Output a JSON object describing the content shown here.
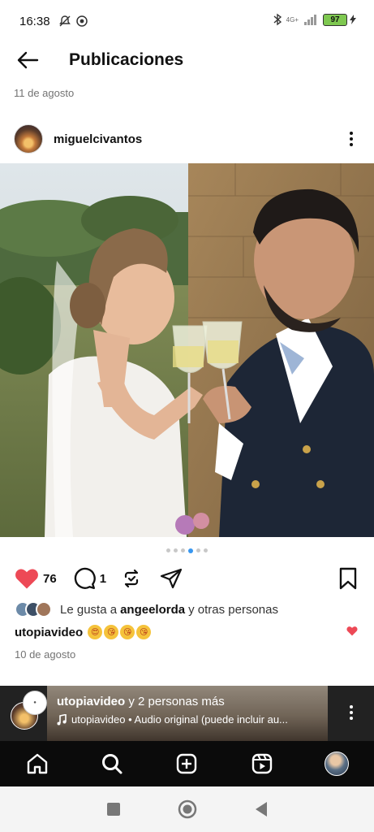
{
  "status_bar": {
    "time": "16:38",
    "network": "4G+",
    "battery": "97"
  },
  "header": {
    "title": "Publicaciones"
  },
  "post": {
    "date_top": "11 de agosto",
    "username": "miguelcivantos",
    "carousel": {
      "count": 6,
      "active_index": 3
    },
    "like_count": "76",
    "comment_count": "1",
    "likes_prefix": "Le gusta a",
    "likes_user": "angeelorda",
    "likes_suffix": "y otras personas",
    "caption_user": "utopiavideo",
    "caption_emoji": [
      "😍",
      "😘",
      "😘",
      "😘"
    ],
    "date_bottom": "10 de agosto"
  },
  "reel": {
    "title_user": "utopiavideo",
    "title_rest": "y 2 personas más",
    "subtitle": "utopiavideo • Audio original (puede incluir au..."
  },
  "colors": {
    "like_red": "#ed4956",
    "carousel_active": "#3897f0"
  },
  "icons": {
    "back": "arrow-left-icon",
    "more": "more-vertical-icon",
    "like": "heart-filled-icon",
    "comment": "comment-icon",
    "repost": "repost-icon",
    "share": "send-icon",
    "bookmark": "bookmark-icon",
    "music": "music-note-icon",
    "home": "home-icon",
    "search": "search-icon",
    "create": "plus-square-icon",
    "reels": "reels-icon"
  }
}
